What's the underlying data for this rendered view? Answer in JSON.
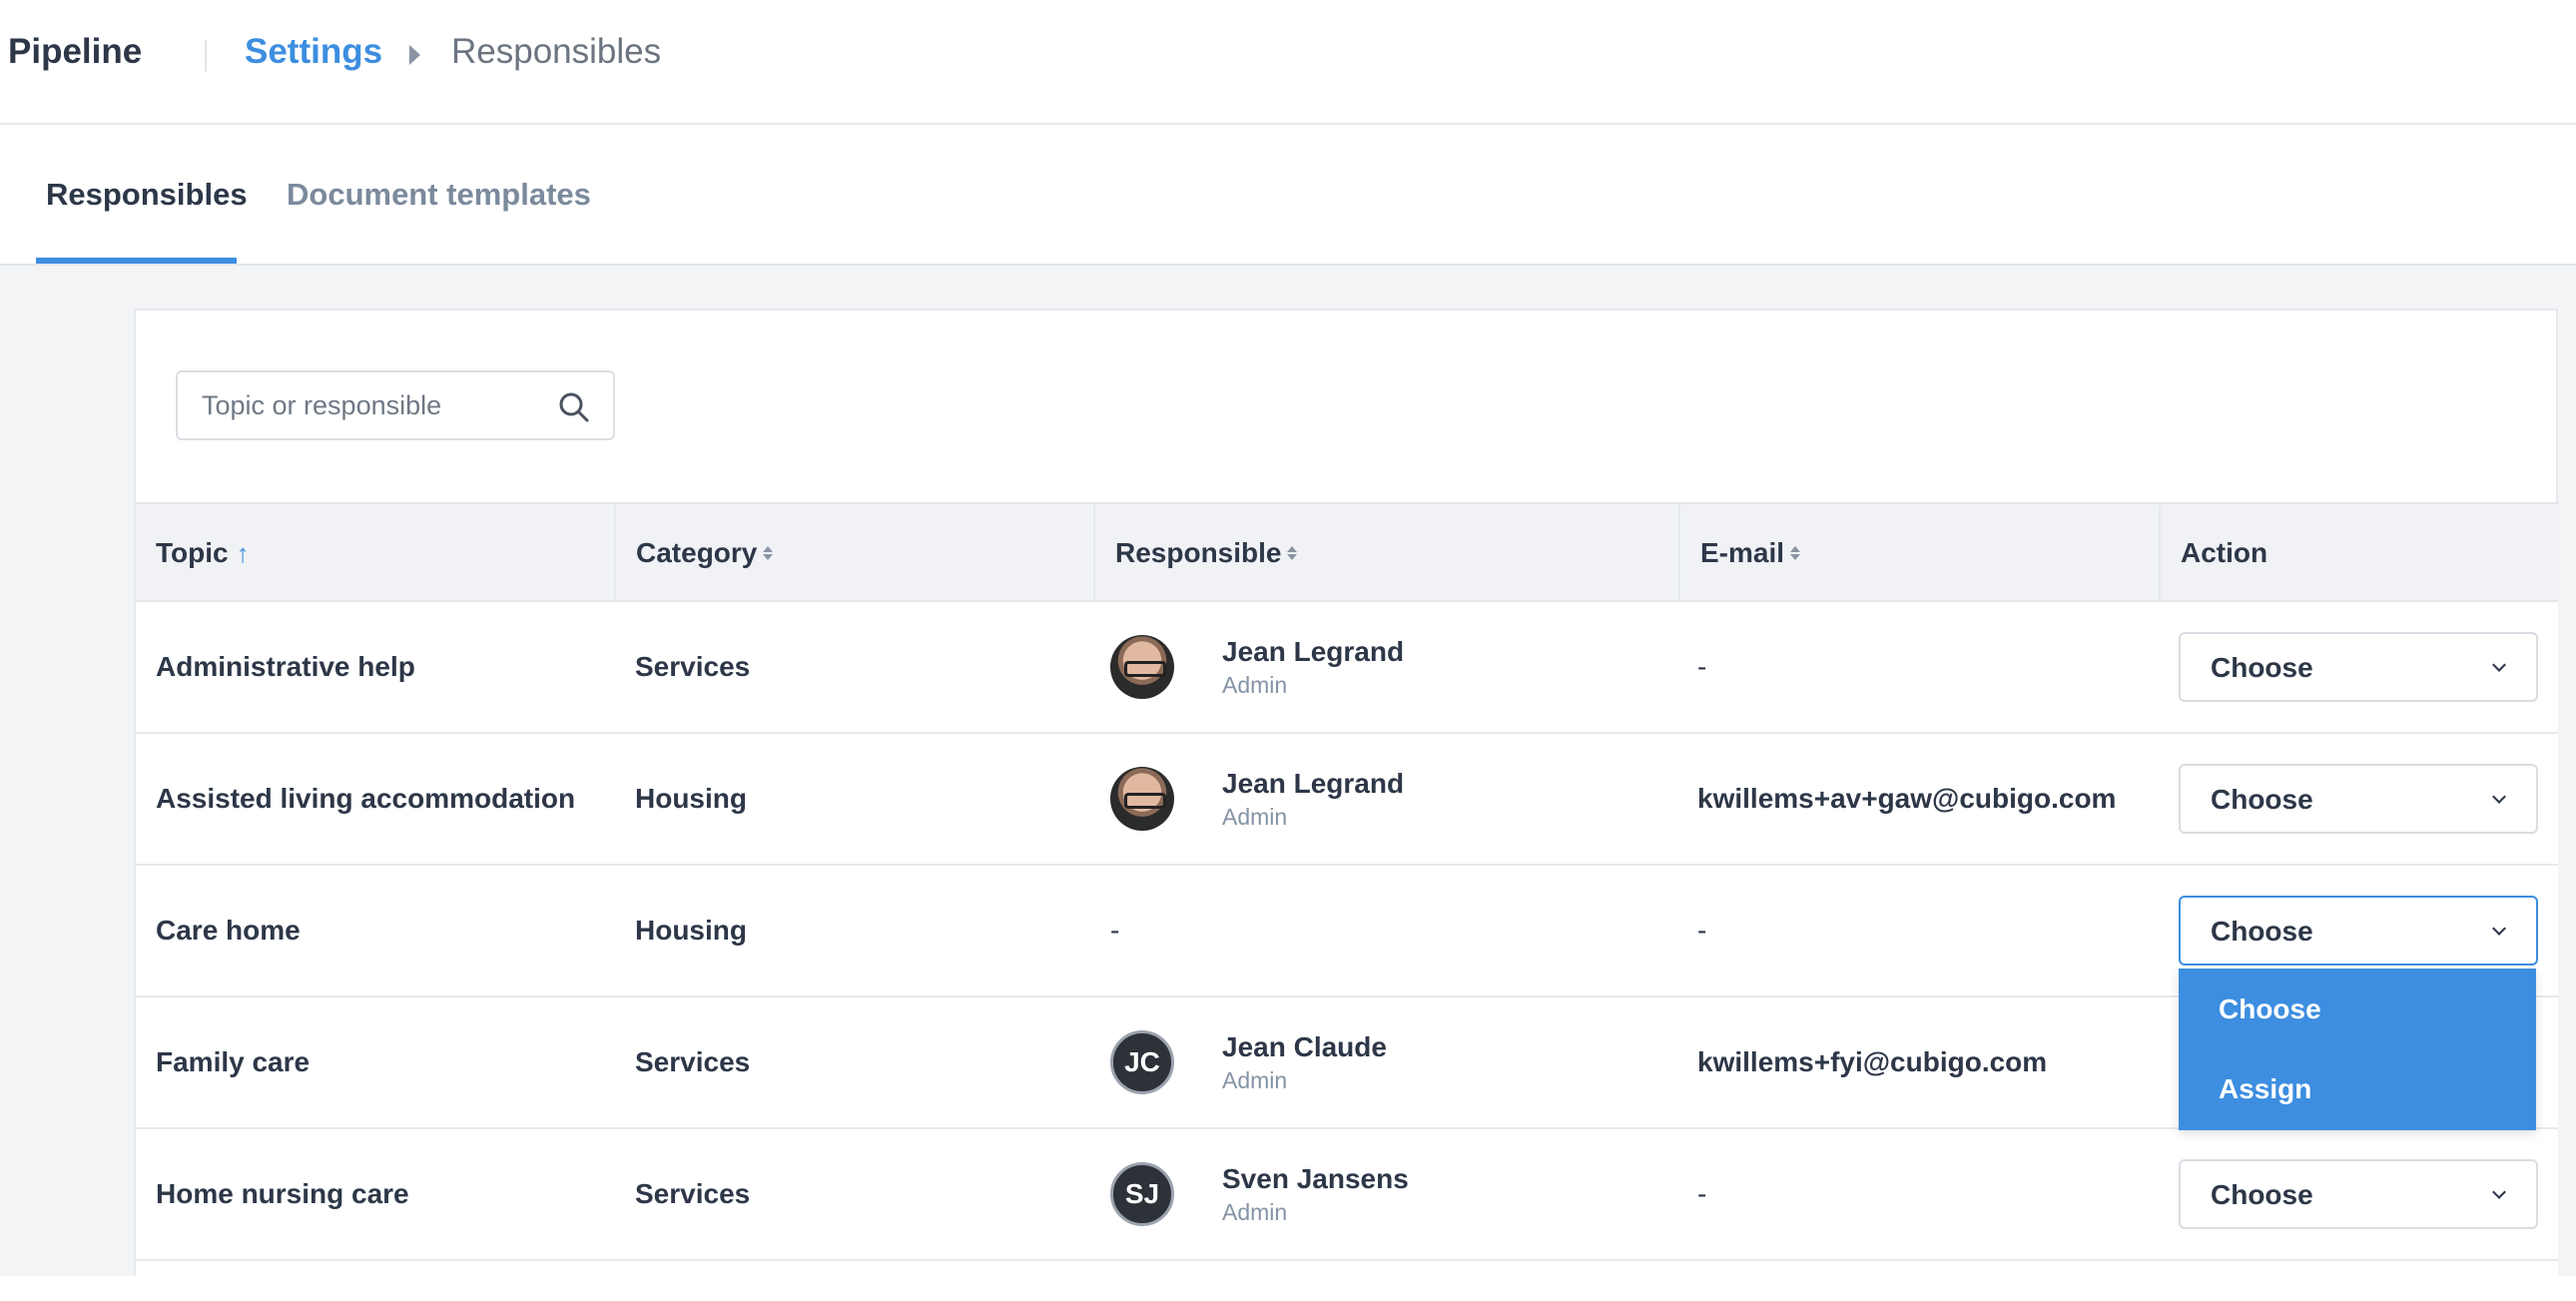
{
  "header": {
    "app_name": "Pipeline",
    "breadcrumb": {
      "parent": "Settings",
      "current": "Responsibles"
    }
  },
  "tabs": [
    {
      "label": "Responsibles",
      "active": true
    },
    {
      "label": "Document templates",
      "active": false
    }
  ],
  "search": {
    "placeholder": "Topic or responsible",
    "value": ""
  },
  "table": {
    "columns": [
      "Topic",
      "Category",
      "Responsible",
      "E-mail",
      "Action"
    ],
    "sort": {
      "column": "Topic",
      "direction": "asc"
    },
    "rows": [
      {
        "topic": "Administrative help",
        "category": "Services",
        "responsible": {
          "name": "Jean Legrand",
          "role": "Admin",
          "avatar": "photo"
        },
        "email": "-",
        "action": "Choose"
      },
      {
        "topic": "Assisted living accommodation",
        "category": "Housing",
        "responsible": {
          "name": "Jean Legrand",
          "role": "Admin",
          "avatar": "photo"
        },
        "email": "kwillems+av+gaw@cubigo.com",
        "action": "Choose"
      },
      {
        "topic": "Care home",
        "category": "Housing",
        "responsible": {
          "name": "-",
          "role": "",
          "avatar": "none"
        },
        "email": "-",
        "action": "Choose"
      },
      {
        "topic": "Family care",
        "category": "Services",
        "responsible": {
          "name": "Jean Claude",
          "role": "Admin",
          "avatar": "JC"
        },
        "email": "kwillems+fyi@cubigo.com",
        "action": "Choose"
      },
      {
        "topic": "Home nursing care",
        "category": "Services",
        "responsible": {
          "name": "Sven Jansens",
          "role": "Admin",
          "avatar": "SJ"
        },
        "email": "-",
        "action": "Choose"
      }
    ]
  },
  "open_dropdown": {
    "row": 2,
    "options": [
      "Choose",
      "Assign"
    ]
  },
  "colors": {
    "accent": "#3d8ee0",
    "text": "#2d3748",
    "muted": "#8593a6"
  }
}
